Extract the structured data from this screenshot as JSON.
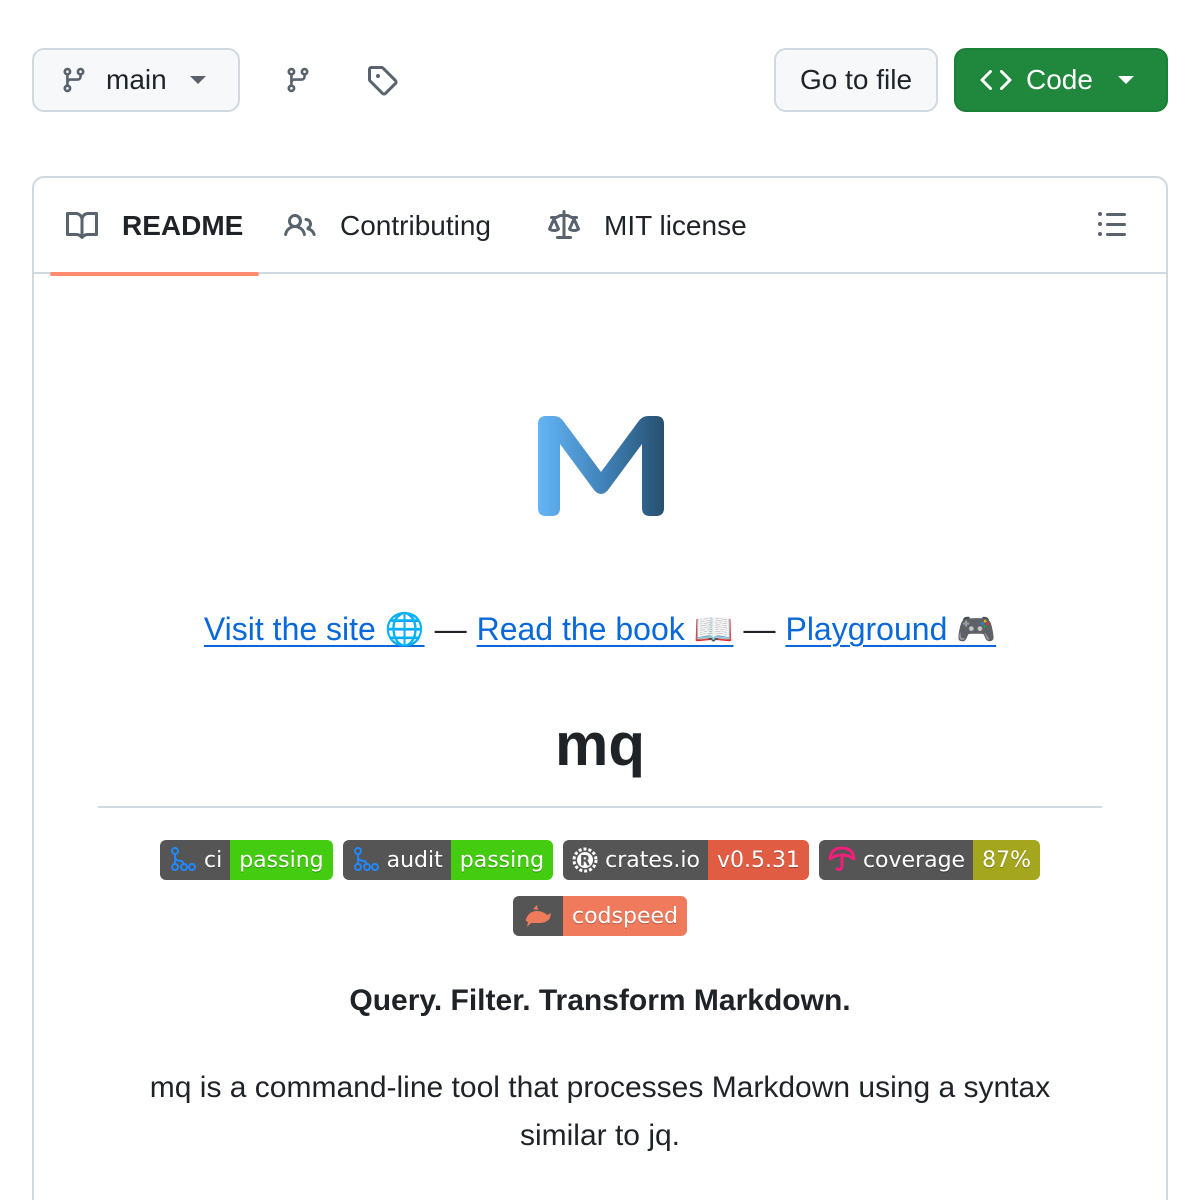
{
  "toolbar": {
    "branch_label": "main",
    "goto_file_label": "Go to file",
    "code_label": "Code"
  },
  "tabs": [
    {
      "label": "README",
      "icon": "book-icon",
      "active": true
    },
    {
      "label": "Contributing",
      "icon": "people-icon"
    },
    {
      "label": "MIT license",
      "icon": "law-icon"
    }
  ],
  "readme": {
    "links": [
      {
        "text": "Visit the site 🌐"
      },
      {
        "text": "Read the book 📖"
      },
      {
        "text": "Playground 🎮"
      }
    ],
    "separator": "—",
    "title": "mq",
    "badges": [
      {
        "label": "ci",
        "value": "passing",
        "value_color": "#4c1",
        "icon": "github-actions-icon"
      },
      {
        "label": "audit",
        "value": "passing",
        "value_color": "#4c1",
        "icon": "github-actions-icon"
      },
      {
        "label": "crates.io",
        "value": "v0.5.31",
        "value_color": "#e05d44",
        "icon": "rust-icon"
      },
      {
        "label": "coverage",
        "value": "87%",
        "value_color": "#a4a61d",
        "icon": "codecov-icon"
      },
      {
        "label": "",
        "value": "codspeed",
        "value_color": "#ef7a5c",
        "icon": "codspeed-icon"
      }
    ],
    "tagline": "Query. Filter. Transform Markdown.",
    "description": "mq is a command-line tool that processes Markdown using a syntax similar to jq."
  },
  "colors": {
    "link": "#0969da",
    "code_button": "#1f883d",
    "active_tab_underline": "#fd8c73"
  }
}
